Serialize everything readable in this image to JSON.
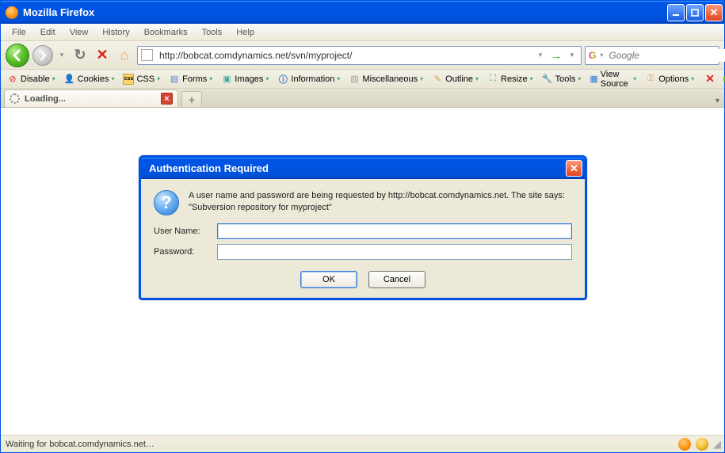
{
  "window": {
    "title": "Mozilla Firefox"
  },
  "menu": {
    "items": [
      "File",
      "Edit",
      "View",
      "History",
      "Bookmarks",
      "Tools",
      "Help"
    ]
  },
  "nav": {
    "url": "http://bobcat.comdynamics.net/svn/myproject/",
    "search_placeholder": "Google"
  },
  "devtoolbar": {
    "items": [
      "Disable",
      "Cookies",
      "CSS",
      "Forms",
      "Images",
      "Information",
      "Miscellaneous",
      "Outline",
      "Resize",
      "Tools",
      "View Source",
      "Options"
    ]
  },
  "tab": {
    "title": "Loading..."
  },
  "dialog": {
    "title": "Authentication Required",
    "message": "A user name and password are being requested by http://bobcat.comdynamics.net. The site says: \"Subversion repository for myproject\"",
    "username_label": "User Name:",
    "password_label": "Password:",
    "username_value": "",
    "password_value": "",
    "ok": "OK",
    "cancel": "Cancel"
  },
  "status": {
    "text": "Waiting for bobcat.comdynamics.net…"
  }
}
